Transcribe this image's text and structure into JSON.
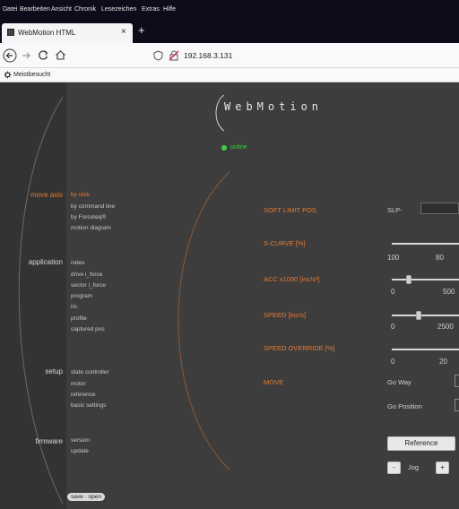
{
  "browser": {
    "menu": [
      "Datei",
      "Bearbeiten",
      "Ansicht",
      "Chronik",
      "Lesezeichen",
      "Extras",
      "Hilfe"
    ],
    "tab_title": "WebMotion HTML",
    "new_tab": "+",
    "close_tab": "×",
    "url": "192.168.3.131",
    "bookmark": "Meistbesucht"
  },
  "app": {
    "logo": "WebMotion",
    "status": "online",
    "status_color": "#3ecf3e",
    "accent_color": "#e87a2e",
    "nav": [
      {
        "label": "move axis",
        "active": true,
        "items": [
          "by click",
          "by command line",
          "by Forceteq®",
          "motion diagram"
        ]
      },
      {
        "label": "application",
        "active": false,
        "items": [
          "index",
          "drive i_force",
          "sector i_force",
          "program",
          "i/o",
          "profile",
          "captured pos"
        ]
      },
      {
        "label": "setup",
        "active": false,
        "items": [
          "state controller",
          "motor",
          "reference",
          "basic settings"
        ]
      },
      {
        "label": "firmware",
        "active": false,
        "items": [
          "version",
          "update"
        ]
      }
    ],
    "save_open": "save · open",
    "fields": {
      "soft_limit": "SOFT LIMIT POS",
      "slp": "SLP-",
      "scurve": "S-CURVE [%]",
      "scurve_scale": [
        "100",
        "80"
      ],
      "acc": "ACC x1000 [inc/s²]",
      "acc_scale": [
        "0",
        "500"
      ],
      "speed": "SPEED [inc/s]",
      "speed_scale": [
        "0",
        "2500"
      ],
      "override": "SPEED OVERRIDE [%]",
      "override_scale": [
        "0",
        "20"
      ],
      "move": "MOVE",
      "go_way": "Go Way",
      "go_position": "Go Position"
    },
    "buttons": {
      "reference": "Reference",
      "jog_minus": "-",
      "jog": "Jog",
      "jog_plus": "+"
    },
    "slider_values": {
      "acc_fraction": 0.25,
      "speed_fraction": 0.4
    }
  }
}
